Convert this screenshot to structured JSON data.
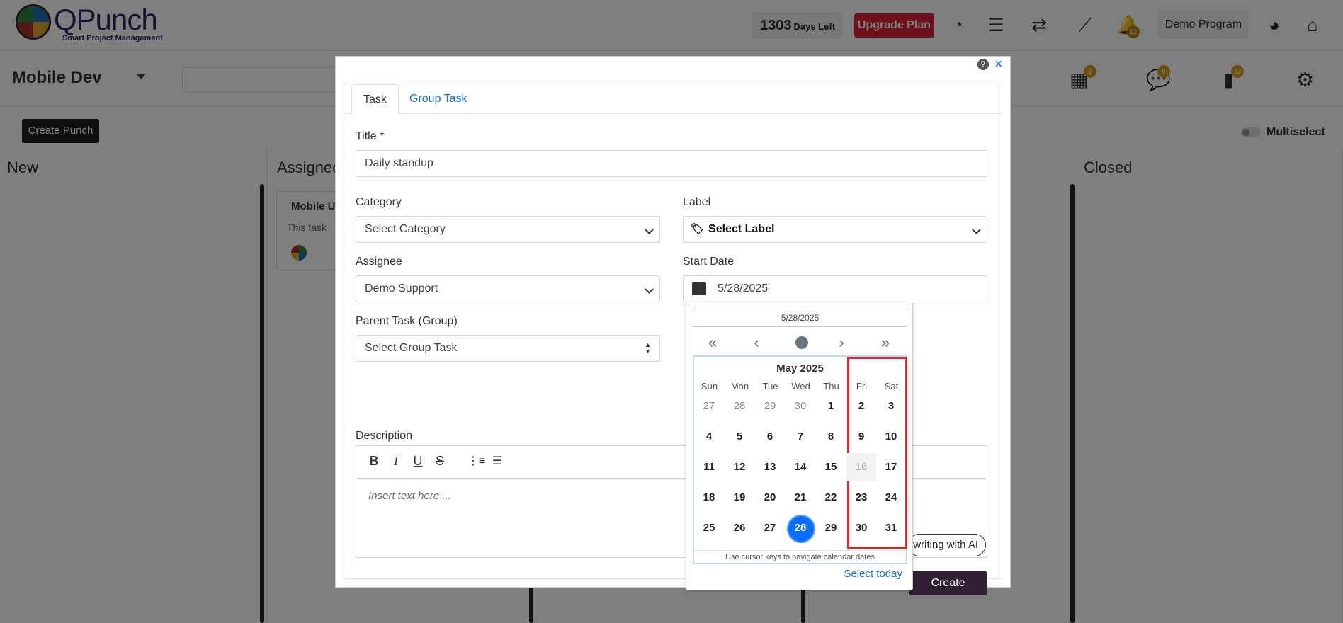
{
  "topbar": {
    "logo_text": "QPunch",
    "logo_sub": "Smart Project Management",
    "days_number": "1303",
    "days_text": "Days Left",
    "upgrade_label": "Upgrade Plan",
    "notification_count": "12",
    "program_label": "Demo Program"
  },
  "subbar": {
    "project_name": "Mobile Dev",
    "create_punch_label": "Create Punch",
    "multiselect_label": "Multiselect",
    "badges": [
      "2",
      "0",
      "12"
    ]
  },
  "board": {
    "columns": [
      "New",
      "Assigned",
      "Closed"
    ],
    "card_title": "Mobile U",
    "card_text": "This task"
  },
  "modal": {
    "tabs": [
      "Task",
      "Group Task"
    ],
    "title_label": "Title *",
    "title_value": "Daily standup",
    "category_label": "Category",
    "category_value": "Select Category",
    "label_label": "Label",
    "label_value": "Select Label",
    "assignee_label": "Assignee",
    "assignee_value": "Demo Support",
    "start_date_label": "Start Date",
    "start_date_value": "5/28/2025",
    "parent_label": "Parent Task (Group)",
    "parent_value": "Select Group Task",
    "description_label": "Description",
    "description_placeholder": "Insert text here ...",
    "ai_button_label": "writing with AI",
    "create_label": "Create"
  },
  "datepicker": {
    "input_value": "5/28/2025",
    "month_label": "May 2025",
    "weekdays": [
      "Sun",
      "Mon",
      "Tue",
      "Wed",
      "Thu",
      "Fri",
      "Sat"
    ],
    "weeks": [
      [
        "27",
        "28",
        "29",
        "30",
        "1",
        "2",
        "3"
      ],
      [
        "4",
        "5",
        "6",
        "7",
        "8",
        "9",
        "10"
      ],
      [
        "11",
        "12",
        "13",
        "14",
        "15",
        "16",
        "17"
      ],
      [
        "18",
        "19",
        "20",
        "21",
        "22",
        "23",
        "24"
      ],
      [
        "25",
        "26",
        "27",
        "28",
        "29",
        "30",
        "31"
      ]
    ],
    "muted_days": [
      "27",
      "28",
      "29",
      "30"
    ],
    "disabled_day": "16",
    "selected_day": "28",
    "footer": "Use cursor keys to navigate calendar dates",
    "today_label": "Select today"
  },
  "colors": {
    "accent": "#1a73e8",
    "upgrade": "#dc2434",
    "create": "#2e1f31",
    "selected": "#0d6efd",
    "highlight": "#dc2626"
  }
}
